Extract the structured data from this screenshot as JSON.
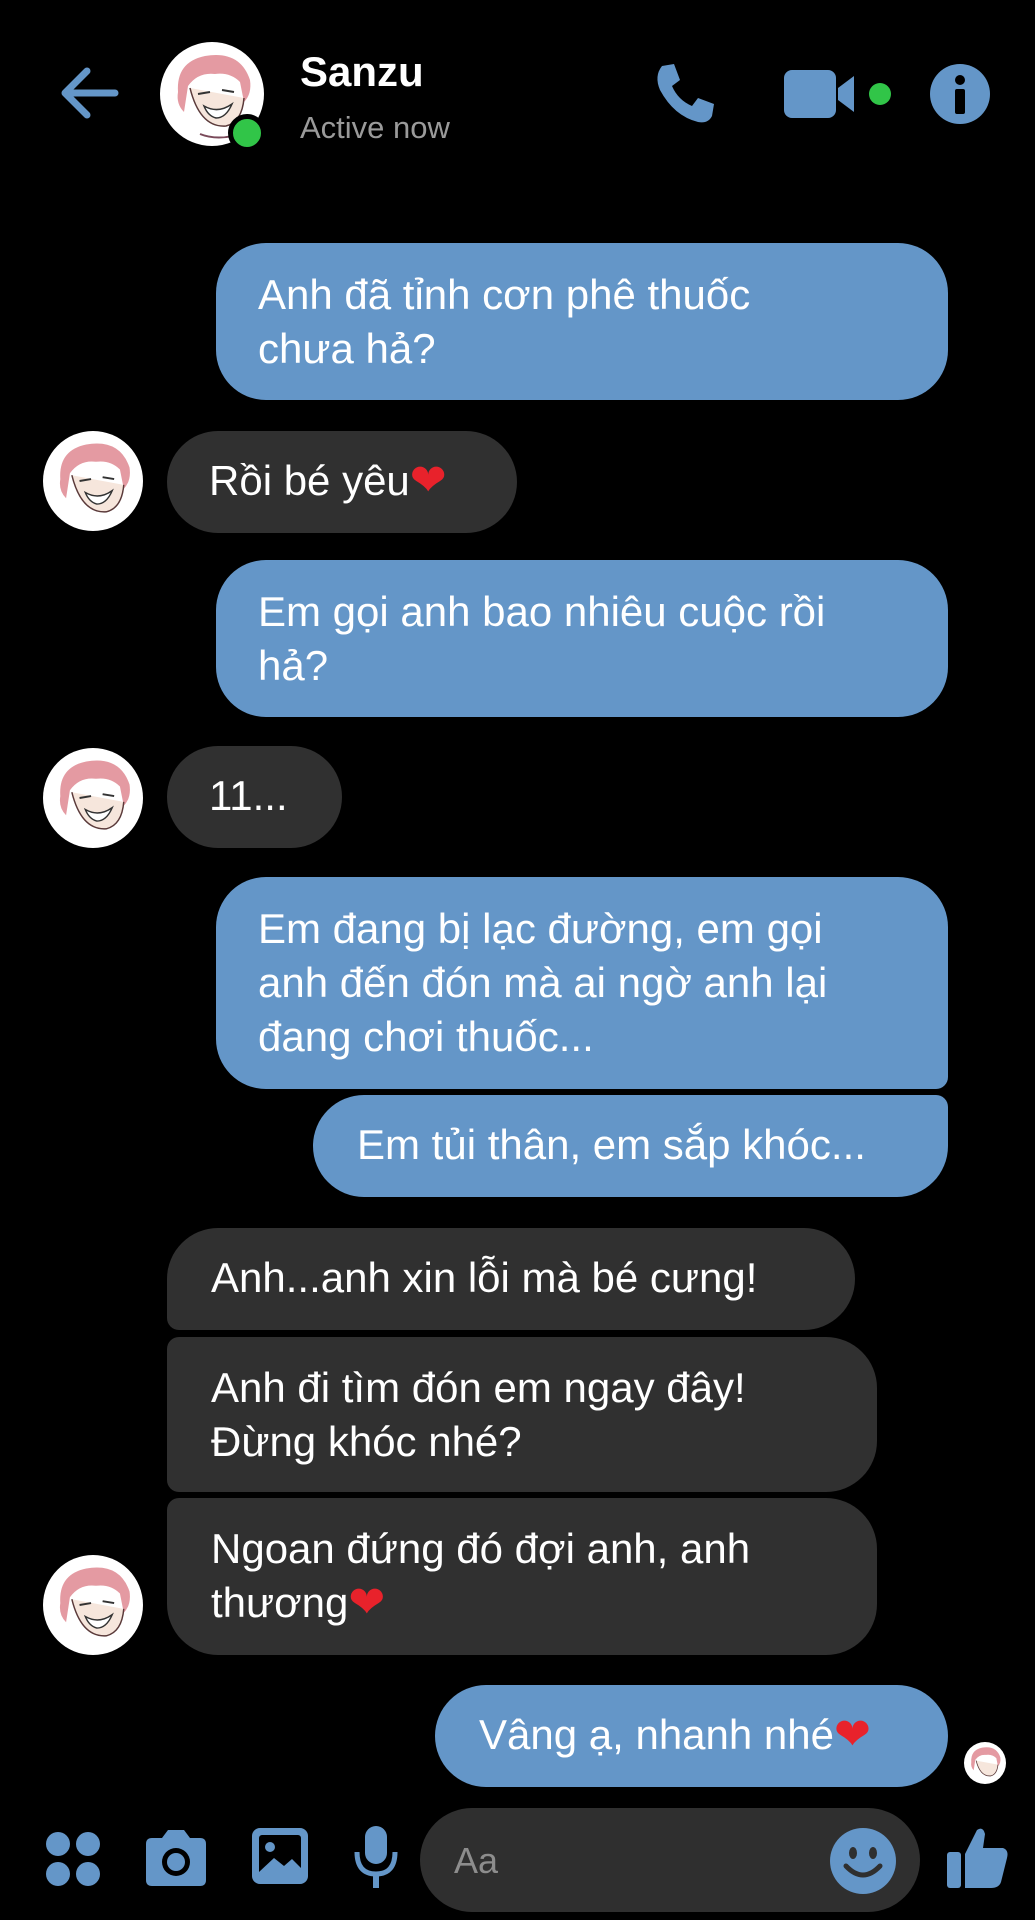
{
  "header": {
    "name": "Sanzu",
    "status": "Active now"
  },
  "messages": [
    {
      "side": "sent",
      "lines": [
        "Anh đã tỉnh cơn phê thuốc",
        "chưa hả?"
      ]
    },
    {
      "side": "received",
      "lines": [
        "Rồi bé yêu"
      ],
      "emoji": "❤"
    },
    {
      "side": "sent",
      "lines": [
        "Em gọi anh bao nhiêu cuộc rồi",
        "hả?"
      ]
    },
    {
      "side": "received",
      "lines": [
        "11..."
      ]
    },
    {
      "side": "sent",
      "lines": [
        "Em đang bị lạc đường, em gọi",
        "anh đến đón mà ai ngờ anh lại",
        "đang chơi thuốc..."
      ]
    },
    {
      "side": "sent",
      "lines": [
        "Em tủi thân, em sắp khóc..."
      ]
    },
    {
      "side": "received",
      "lines": [
        "Anh...anh xin lỗi mà bé cưng!"
      ]
    },
    {
      "side": "received",
      "lines": [
        "Anh đi tìm đón em ngay đây!",
        "Đừng khóc nhé?"
      ]
    },
    {
      "side": "received",
      "lines": [
        "Ngoan đứng đó đợi anh, anh",
        "thương"
      ],
      "emoji": "❤"
    },
    {
      "side": "sent",
      "lines": [
        "Vâng ạ, nhanh nhé"
      ],
      "emoji": "❤"
    }
  ],
  "composer": {
    "placeholder": "Aa"
  },
  "colors": {
    "accent": "#6496c8",
    "received_bubble": "#303030",
    "online": "#31c548",
    "heart": "#e8222b"
  },
  "icons": {
    "back": "arrow-left-icon",
    "call": "phone-icon",
    "video": "video-camera-icon",
    "info": "info-icon",
    "apps": "four-dots-icon",
    "camera": "camera-icon",
    "gallery": "image-icon",
    "mic": "microphone-icon",
    "emoji": "smiley-icon",
    "like": "thumbs-up-icon"
  }
}
